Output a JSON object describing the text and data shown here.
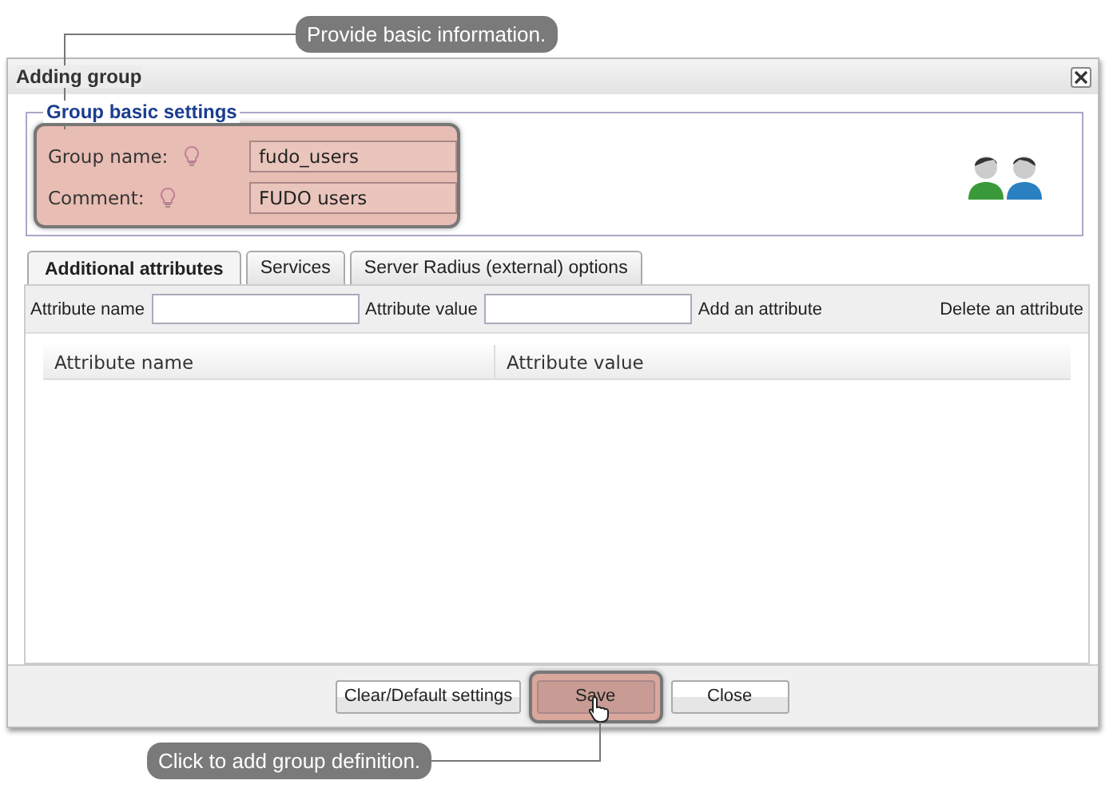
{
  "callouts": [
    {
      "text": "Provide basic information."
    },
    {
      "text": "Click to add group definition."
    }
  ],
  "window": {
    "title": "Adding group"
  },
  "fieldset": {
    "legend": "Group basic settings",
    "fields": [
      {
        "label": "Group name:",
        "value": "fudo_users"
      },
      {
        "label": "Comment:",
        "value": "FUDO users"
      }
    ]
  },
  "tabs": [
    {
      "label": "Additional attributes",
      "selected": true
    },
    {
      "label": "Services",
      "selected": false
    },
    {
      "label": "Server Radius (external) options",
      "selected": false
    }
  ],
  "toolbar": {
    "name_label": "Attribute name",
    "value_label": "Attribute value",
    "add": "Add an attribute",
    "delete": "Delete an attribute"
  },
  "table": {
    "columns": [
      "Attribute name",
      "Attribute value"
    ]
  },
  "buttons": [
    {
      "label": "Clear/Default settings",
      "highlighted": false
    },
    {
      "label": "Save",
      "highlighted": true
    },
    {
      "label": "Close",
      "highlighted": false
    }
  ]
}
